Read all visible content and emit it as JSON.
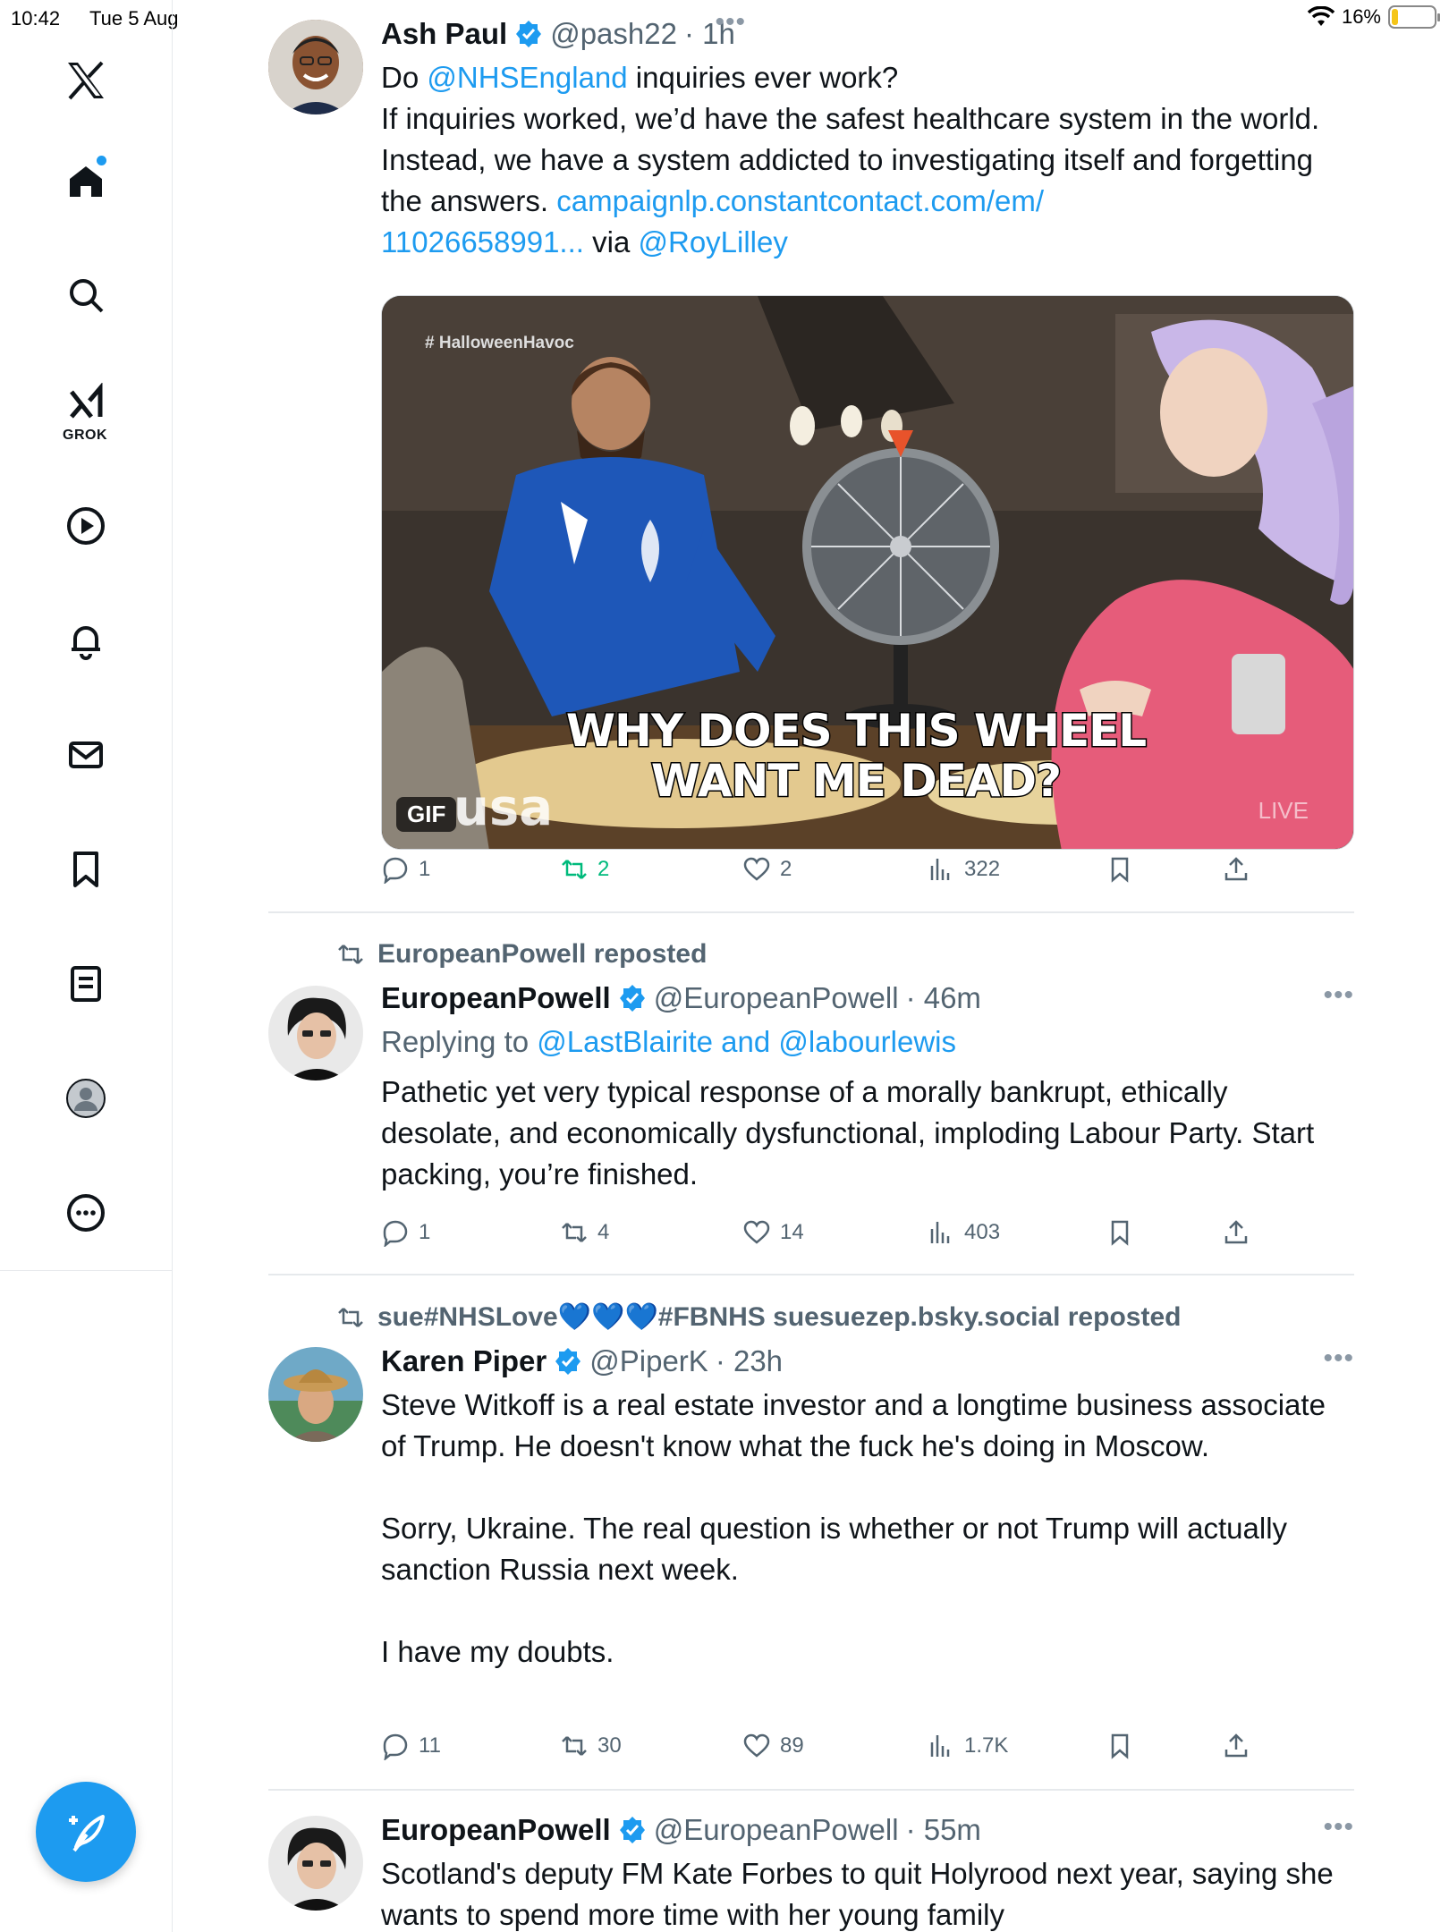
{
  "status_bar": {
    "time": "10:42",
    "date": "Tue 5 Aug",
    "battery": "16%",
    "battery_level": 0.16
  },
  "sidebar": {
    "grok_label": "GROK",
    "icons": [
      "x-logo-icon",
      "home-icon",
      "search-icon",
      "grok-icon",
      "video-icon",
      "notifications-icon",
      "messages-icon",
      "bookmarks-icon",
      "lists-icon",
      "profile-icon",
      "more-icon"
    ]
  },
  "colors": {
    "accent": "#1d9bf0",
    "repost_green": "#00ba7c",
    "muted": "#536471"
  },
  "tweets": [
    {
      "name": "Ash Paul",
      "handle": "@pash22",
      "time": "· 1h",
      "text_lead": "Do ",
      "mention": "@NHSEngland",
      "text_main": " inquiries ever work?\nIf inquiries worked, we’d have the safest healthcare system in the world. Instead, we have a system addicted to investigating itself and forgetting the answers. ",
      "link": "campaignlp.constantcontact.com/em/\n11026658991...",
      "via": " via ",
      "via_mention": "@RoyLilley",
      "media": {
        "hashtag": "# HalloweenHavoc",
        "caption": "WHY DOES THIS WHEEL\nWANT ME DEAD?",
        "badge": "GIF",
        "watermark": "usa",
        "corner": "LIVE"
      },
      "stats": {
        "replies": "1",
        "reposts": "2",
        "likes": "2",
        "views": "322"
      }
    },
    {
      "reposted_by": "EuropeanPowell reposted",
      "name": "EuropeanPowell",
      "handle": "@EuropeanPowell",
      "time": "· 46m",
      "replying_prefix": "Replying to ",
      "replying_to": "@LastBlairite and @labourlewis",
      "text": "Pathetic yet very typical response of a morally bankrupt, ethically desolate, and economically dysfunctional, imploding Labour Party. Start packing, you’re finished.",
      "stats": {
        "replies": "1",
        "reposts": "4",
        "likes": "14",
        "views": "403"
      }
    },
    {
      "reposted_by": "sue#NHSLove💙💙💙#FBNHS suesuezep.bsky.social reposted",
      "name": "Karen Piper",
      "handle": "@PiperK",
      "time": "· 23h",
      "text": "Steve Witkoff is a real estate investor and a longtime business associate of Trump. He doesn't know what the fuck he's doing in Moscow.\n\nSorry, Ukraine. The real question is whether or not Trump will actually sanction Russia next week.\n\nI have my doubts.",
      "stats": {
        "replies": "11",
        "reposts": "30",
        "likes": "89",
        "views": "1.7K"
      }
    },
    {
      "name": "EuropeanPowell",
      "handle": "@EuropeanPowell",
      "time": "· 55m",
      "text": "Scotland's deputy FM Kate Forbes to quit Holyrood next year, saying she wants to spend more time with her young family"
    }
  ]
}
